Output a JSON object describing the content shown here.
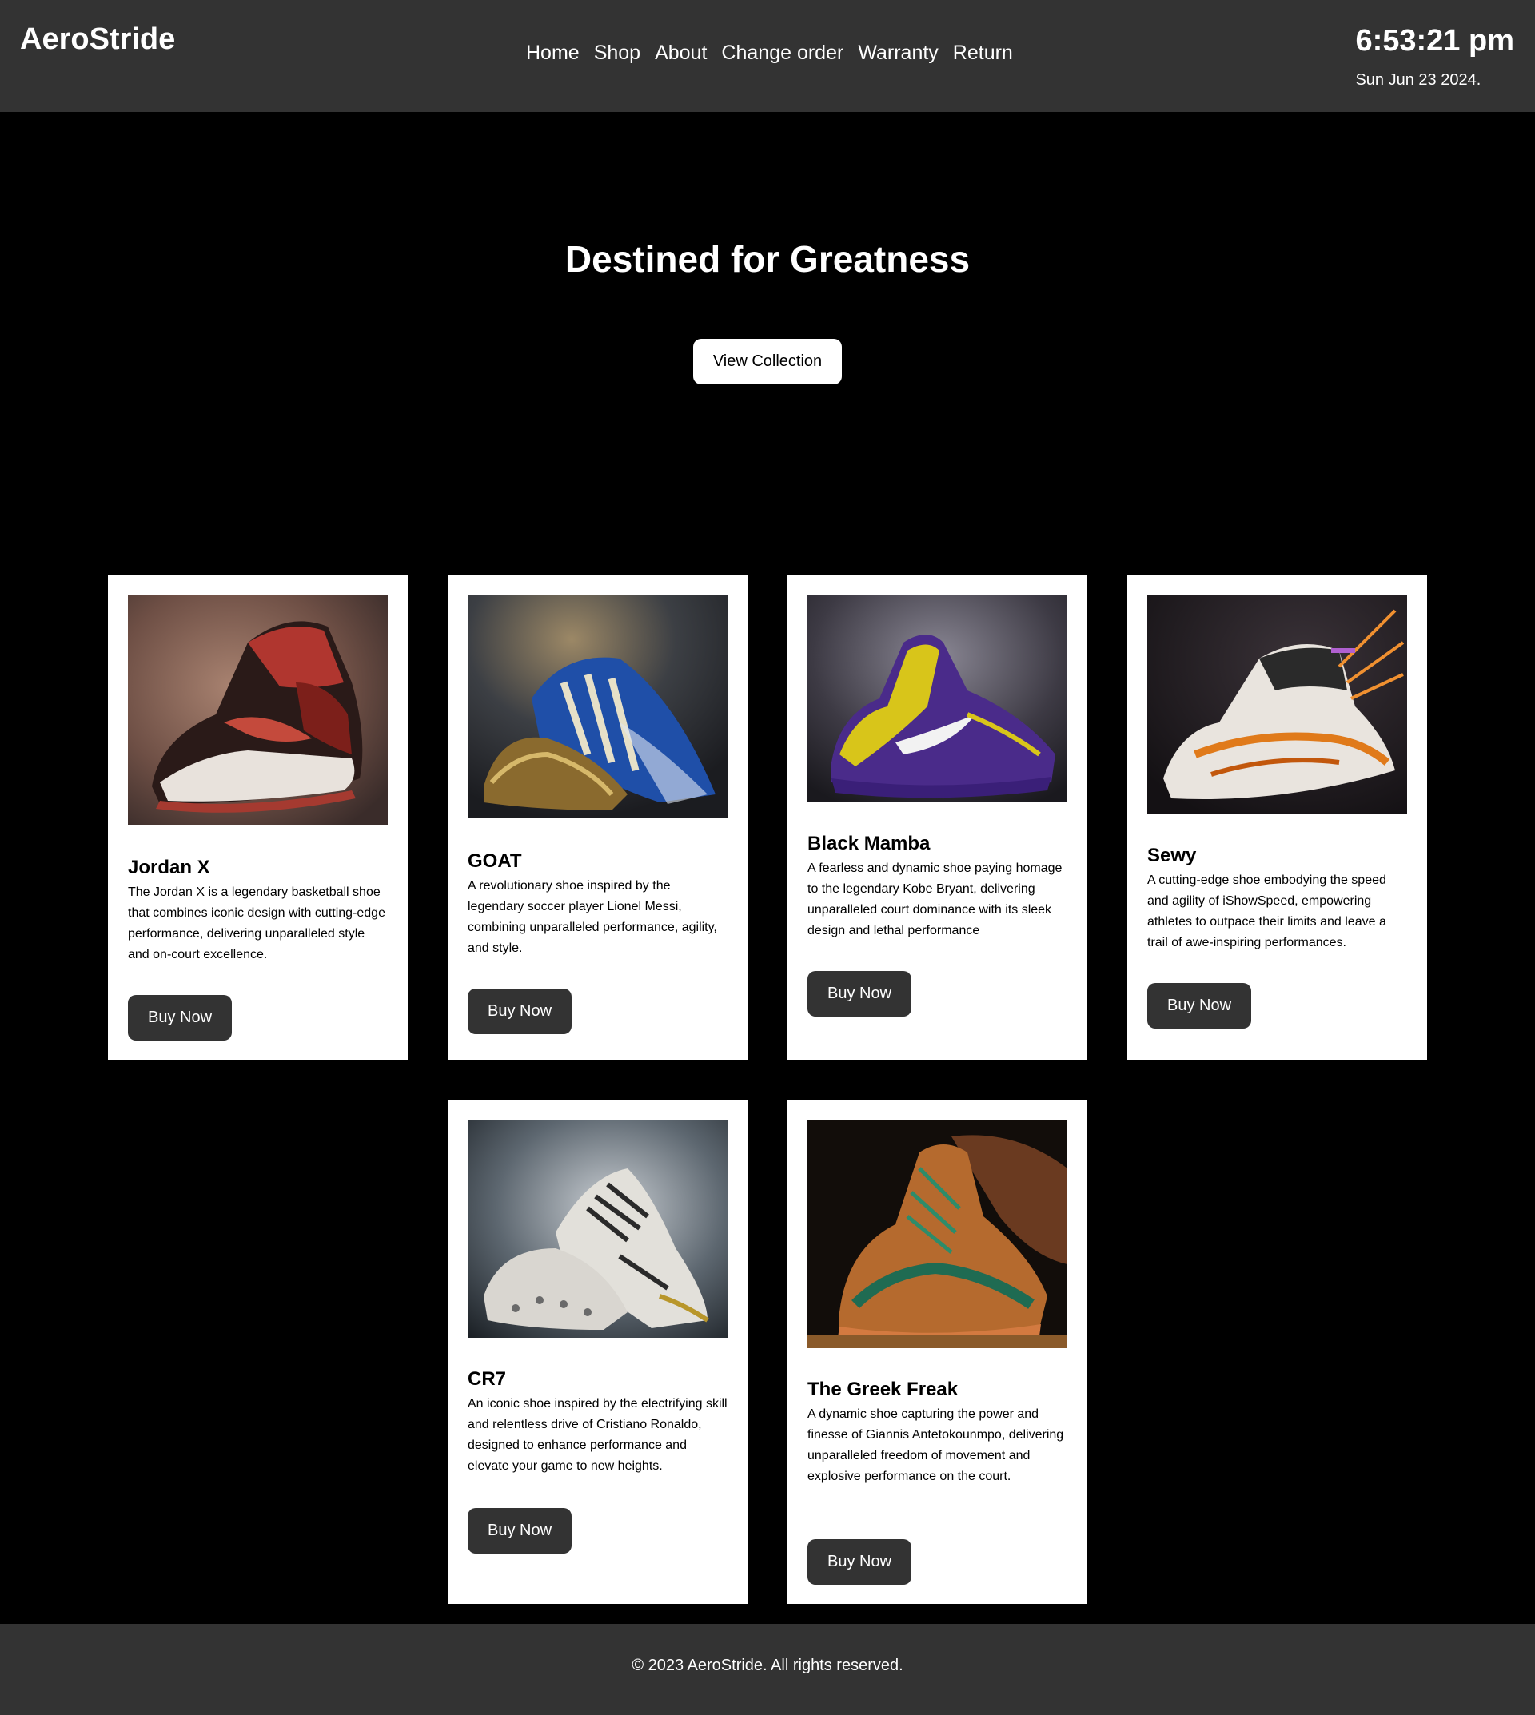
{
  "header": {
    "brand": "AeroStride",
    "nav": [
      "Home",
      "Shop",
      "About",
      "Change order",
      "Warranty",
      "Return"
    ],
    "time": "6:53:21 pm",
    "date": "Sun Jun 23 2024."
  },
  "hero": {
    "title": "Destined for Greatness",
    "button": "View Collection"
  },
  "products": [
    {
      "name": "Jordan X",
      "description": "The Jordan X is a legendary basketball shoe that combines iconic design with cutting-edge performance, delivering unparalleled style and on-court excellence.",
      "button": "Buy Now",
      "image": "red-black-high-top-sneaker"
    },
    {
      "name": "GOAT",
      "description": "A revolutionary shoe inspired by the legendary soccer player Lionel Messi, combining unparalleled performance, agility, and style.",
      "button": "Buy Now",
      "image": "blue-gold-football-boots"
    },
    {
      "name": "Black Mamba",
      "description": "A fearless and dynamic shoe paying homage to the legendary Kobe Bryant, delivering unparalleled court dominance with its sleek design and lethal performance",
      "button": "Buy Now",
      "image": "purple-yellow-basketball-shoe"
    },
    {
      "name": "Sewy",
      "description": "A cutting-edge shoe embodying the speed and agility of iShowSpeed, empowering athletes to outpace their limits and leave a trail of awe-inspiring performances.",
      "button": "Buy Now",
      "image": "white-orange-running-shoe"
    },
    {
      "name": "CR7",
      "description": "An iconic shoe inspired by the electrifying skill and relentless drive of Cristiano Ronaldo, designed to enhance performance and elevate your game to new heights.",
      "button": "Buy Now",
      "image": "white-gold-football-boots"
    },
    {
      "name": "The Greek Freak",
      "description": "A dynamic shoe capturing the power and finesse of Giannis Antetokounmpo, delivering unparalleled freedom of movement and explosive performance on the court.",
      "button": "Buy Now",
      "image": "orange-green-basketball-shoe"
    }
  ],
  "footer": {
    "text": "© 2023 AeroStride. All rights reserved."
  }
}
